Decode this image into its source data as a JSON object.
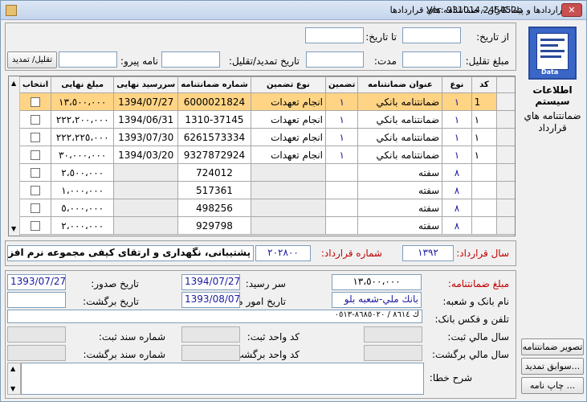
{
  "title": "قراردادها و پیمانکاران - ضمانتنامه هاي قراردادها",
  "version": "Ver: 931014,245452b",
  "close_label": "✕",
  "side": {
    "heading": "اطلاعات سيستم",
    "sub": "ضمانتنامه هاي قرارداد",
    "logo_text": "Data"
  },
  "filter": {
    "from_date_label": "از تاریخ:",
    "to_date_label": "تا تاریخ:",
    "amount_label": "مبلغ تقلیل:",
    "duration_label": "مدت:",
    "ext_date_label": "تاریخ تمدید/تقلیل:",
    "letter_label": "نامه پیرو:",
    "ext_btn": "تقلیل/ تمدید"
  },
  "table": {
    "headers": [
      "کد",
      "نوع",
      "عنوان ضمانتنامه",
      "تضمین",
      "نوع تضمین",
      "شماره ضمانتنامه",
      "سررسید نهایی",
      "مبلغ نهایی",
      "انتخاب"
    ],
    "rows": [
      {
        "code": "1",
        "type": "١",
        "title": "ضمانتنامه بانكي",
        "guar": "١",
        "gtype": "انجام تعهدات",
        "num": "6000021824",
        "due": "1394/07/27",
        "amount": "١٣،٥٠٠،٠٠٠",
        "selected": true
      },
      {
        "code": "١",
        "type": "١",
        "title": "ضمانتنامه بانكي",
        "guar": "١",
        "gtype": "انجام تعهدات",
        "num": "1310-37145",
        "due": "1394/06/31",
        "amount": "٢٢٢،٢٠٠،٠٠٠",
        "selected": false
      },
      {
        "code": "١",
        "type": "١",
        "title": "ضمانتنامه بانكي",
        "guar": "١",
        "gtype": "انجام تعهدات",
        "num": "6261573334",
        "due": "1393/07/30",
        "amount": "٢٢٢،٢٢٥،٠٠٠",
        "selected": false
      },
      {
        "code": "١",
        "type": "١",
        "title": "ضمانتنامه بانكي",
        "guar": "١",
        "gtype": "انجام تعهدات",
        "num": "9327872924",
        "due": "1394/03/20",
        "amount": "٣٠،٠٠٠،٠٠٠",
        "selected": false
      },
      {
        "code": "",
        "type": "٨",
        "title": "سفته",
        "guar": "",
        "gtype": "",
        "num": "724012",
        "due": "",
        "amount": "٢،٥٠٠،٠٠٠",
        "selected": false
      },
      {
        "code": "",
        "type": "٨",
        "title": "سفته",
        "guar": "",
        "gtype": "",
        "num": "517361",
        "due": "",
        "amount": "١،٠٠٠،٠٠٠",
        "selected": false
      },
      {
        "code": "",
        "type": "٨",
        "title": "سفته",
        "guar": "",
        "gtype": "",
        "num": "498256",
        "due": "",
        "amount": "٥،٠٠٠،٠٠٠",
        "selected": false
      },
      {
        "code": "",
        "type": "٨",
        "title": "سفته",
        "guar": "",
        "gtype": "",
        "num": "929798",
        "due": "",
        "amount": "٢،٠٠٠،٠٠٠",
        "selected": false
      }
    ]
  },
  "contract": {
    "year_label": "سال قرارداد:",
    "year": "١٣٩٢",
    "num_label": "شماره قرارداد:",
    "num": "٢٠٢٨٠٠",
    "desc": "پشتیبانی، نگهداری و ارتقای کیفی مجموعه نرم افزارهای"
  },
  "detail": {
    "amount_label": "مبلغ ضمانتنامه:",
    "amount": "١٣،٥٠٠،٠٠٠",
    "due_label": "سر رسید:",
    "due": "1394/07/27",
    "issue_label": "تاریخ صدور:",
    "issue": "1393/07/27",
    "bank_label": "نام بانک و شعبه:",
    "bank": "بانك ملي-شعبه بلو",
    "fin_label": "تاریخ امور مالي:",
    "fin": "1393/08/07",
    "return_date_label": "تاریخ برگشت:",
    "return_date": "",
    "phone_label": "تلفن و فکس بانک:",
    "phone": "ك ٨٦١٤ / ٨٦٨٥٠٢٠-٠٥١٣",
    "fy_reg_label": "سال مالي ثبت:",
    "unit_reg_label": "کد واحد ثبت:",
    "doc_reg_label": "شماره سند ثبت:",
    "fy_ret_label": "سال مالي برگشت:",
    "unit_ret_label": "کد واحد برگشت:",
    "doc_ret_label": "شماره سند برگشت:",
    "err_label": "شرح خطا:"
  },
  "buttons": {
    "image": "تصویر ضمانتنامه",
    "history": "سوابق تمدید...",
    "print": "چاپ نامه ..."
  }
}
